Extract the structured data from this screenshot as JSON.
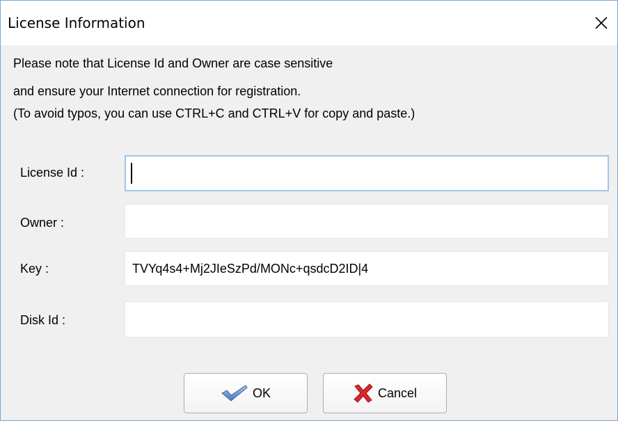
{
  "window": {
    "title": "License Information"
  },
  "notes": [
    "Please note that License Id and Owner are case sensitive",
    "and ensure your Internet connection for registration.",
    "(To avoid typos, you can use CTRL+C and CTRL+V for copy and paste.)"
  ],
  "fields": {
    "license_id": {
      "label": "License Id :",
      "value": ""
    },
    "owner": {
      "label": "Owner :",
      "value": ""
    },
    "key": {
      "label": "Key :",
      "value": "TVYq4s4+Mj2JIeSzPd/MONc+qsdcD2ID|4"
    },
    "disk_id": {
      "label": "Disk Id :",
      "value": ""
    }
  },
  "buttons": {
    "ok_label": "OK",
    "cancel_label": "Cancel"
  },
  "icons": {
    "close": "close-icon",
    "ok": "checkmark-icon",
    "cancel": "red-x-icon"
  },
  "colors": {
    "focus_border": "#9cc7ea",
    "window_border": "#7aa6d2",
    "cancel_icon": "#d9262c",
    "ok_icon": "#5b86c5"
  }
}
